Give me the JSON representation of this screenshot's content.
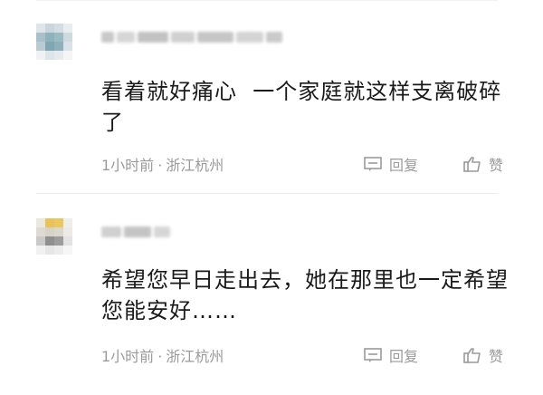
{
  "comments": [
    {
      "text": "看着就好痛心  一个家庭就这样支离破碎了",
      "time": "1小时前",
      "separator": "·",
      "location": "浙江杭州",
      "reply_label": "回复",
      "like_label": "赞",
      "reply_icon": "comment-bubble-icon",
      "like_icon": "thumbs-up-icon"
    },
    {
      "text": "希望您早日走出去，她在那里也一定希望您能安好……",
      "time": "1小时前",
      "separator": "·",
      "location": "浙江杭州",
      "reply_label": "回复",
      "like_label": "赞",
      "reply_icon": "comment-bubble-icon",
      "like_icon": "thumbs-up-icon"
    }
  ],
  "colors": {
    "text": "#1a1a1a",
    "meta": "#9a9a9a",
    "divider": "#ececec"
  }
}
